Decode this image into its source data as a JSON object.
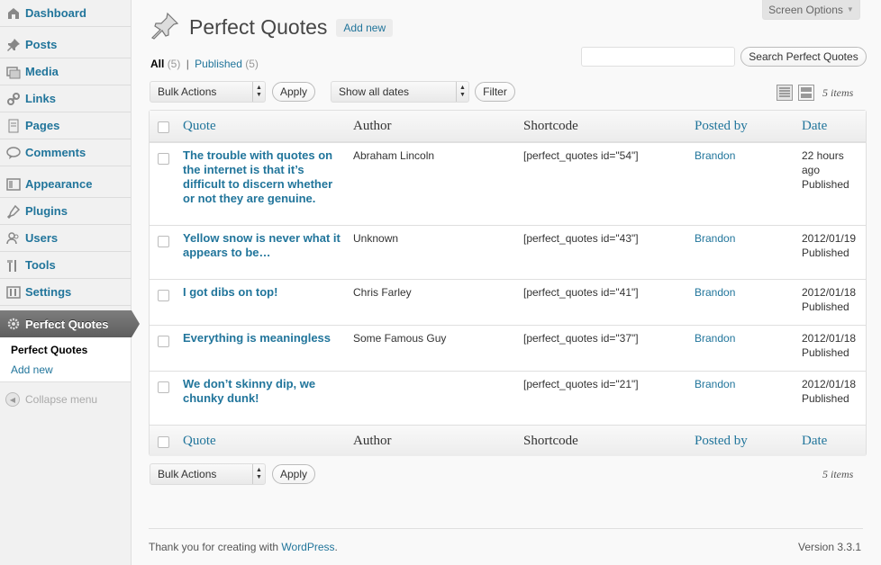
{
  "sidebar": {
    "items": [
      {
        "label": "Dashboard",
        "icon": "dashboard-icon"
      },
      {
        "label": "Posts",
        "icon": "pushpin-icon"
      },
      {
        "label": "Media",
        "icon": "media-icon"
      },
      {
        "label": "Links",
        "icon": "link-icon"
      },
      {
        "label": "Pages",
        "icon": "pages-icon"
      },
      {
        "label": "Comments",
        "icon": "comment-icon"
      },
      {
        "label": "Appearance",
        "icon": "appearance-icon"
      },
      {
        "label": "Plugins",
        "icon": "plugin-icon"
      },
      {
        "label": "Users",
        "icon": "users-icon"
      },
      {
        "label": "Tools",
        "icon": "tools-icon"
      },
      {
        "label": "Settings",
        "icon": "settings-icon"
      }
    ],
    "active": {
      "label": "Perfect Quotes",
      "icon": "gear-icon"
    },
    "submenu": [
      "Perfect Quotes",
      "Add new"
    ],
    "collapse": "Collapse menu"
  },
  "header": {
    "screen_options": "Screen Options",
    "title": "Perfect Quotes",
    "add_new": "Add new"
  },
  "filters": {
    "all_label": "All",
    "all_count": "(5)",
    "separator": "|",
    "published_label": "Published",
    "published_count": "(5)",
    "search_placeholder": "",
    "search_button": "Search Perfect Quotes",
    "bulk_actions": "Bulk Actions",
    "apply": "Apply",
    "dates": "Show all dates",
    "filter": "Filter",
    "items_count": "5 items"
  },
  "table": {
    "columns": [
      "Quote",
      "Author",
      "Shortcode",
      "Posted by",
      "Date"
    ],
    "rows": [
      {
        "quote": "The trouble with quotes on the internet is that it’s difficult to discern whether or not they are genuine.",
        "author": "Abraham Lincoln",
        "shortcode": "[perfect_quotes id=\"54\"]",
        "posted_by": "Brandon",
        "date": "22 hours ago",
        "status": "Published"
      },
      {
        "quote": "Yellow snow is never what it appears to be…",
        "author": "Unknown",
        "shortcode": "[perfect_quotes id=\"43\"]",
        "posted_by": "Brandon",
        "date": "2012/01/19",
        "status": "Published"
      },
      {
        "quote": "I got dibs on top!",
        "author": "Chris Farley",
        "shortcode": "[perfect_quotes id=\"41\"]",
        "posted_by": "Brandon",
        "date": "2012/01/18",
        "status": "Published"
      },
      {
        "quote": "Everything is meaningless",
        "author": "Some Famous Guy",
        "shortcode": "[perfect_quotes id=\"37\"]",
        "posted_by": "Brandon",
        "date": "2012/01/18",
        "status": "Published"
      },
      {
        "quote": "We don’t skinny dip, we chunky dunk!",
        "author": "",
        "shortcode": "[perfect_quotes id=\"21\"]",
        "posted_by": "Brandon",
        "date": "2012/01/18",
        "status": "Published"
      }
    ]
  },
  "footer": {
    "thanks": "Thank you for creating with ",
    "wp_link": "WordPress",
    "period": ".",
    "version": "Version 3.3.1"
  }
}
